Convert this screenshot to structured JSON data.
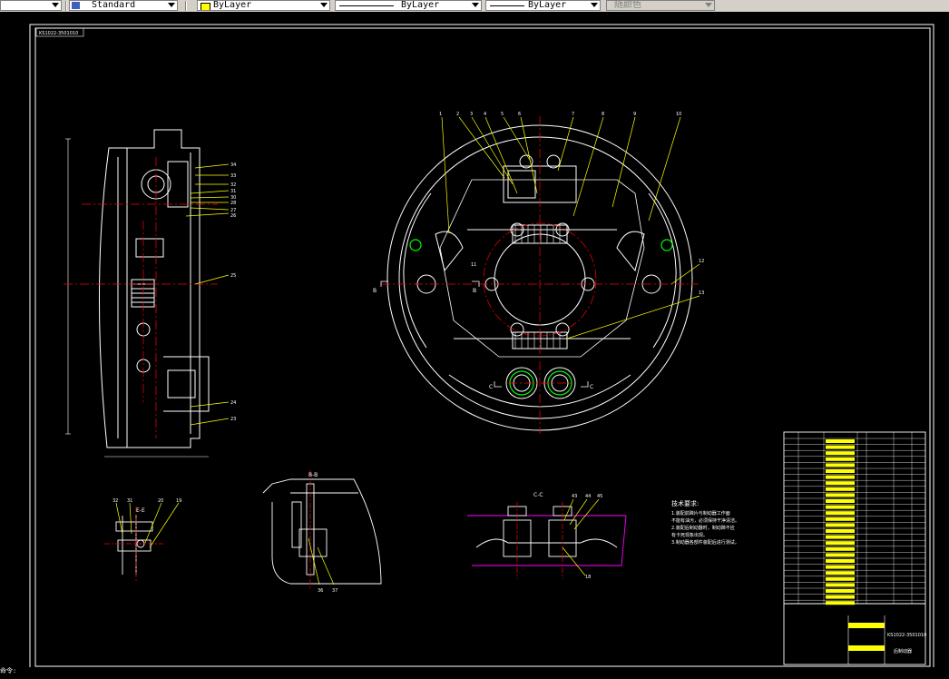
{
  "toolbar": {
    "text_style": "Standard",
    "layer": "ByLayer",
    "linetype": "ByLayer",
    "lineweight": "ByLayer",
    "plot_style": "随颜色"
  },
  "drawing": {
    "title_tag": "KS1022-3501010",
    "section_bb": "B-B",
    "section_cc": "C-C",
    "section_ee": "E-E",
    "label_b": "B",
    "label_c": "C",
    "tech_title": "技术要求:",
    "tech_lines": [
      "1.装配前蹄片与制动器工作面",
      "  不能有油污，必须保持干净清洁。",
      "2.装配后制动器时，制动蹄不应",
      "  有卡死现象出现。",
      "3.制动器各部件装配后进行测试。"
    ],
    "title_block_code": "KS1022-3501010",
    "title_block_name": "后制动器"
  },
  "callouts": {
    "front": [
      "1",
      "2",
      "3",
      "4",
      "5",
      "6",
      "7",
      "8",
      "9",
      "10",
      "11",
      "12",
      "13"
    ],
    "side": [
      "34",
      "33",
      "32",
      "31",
      "30",
      "28",
      "27",
      "26",
      "25",
      "24",
      "23"
    ],
    "ee": [
      "32",
      "31",
      "20",
      "19"
    ],
    "bb": [
      "36",
      "37"
    ],
    "cc": [
      "43",
      "44",
      "45",
      "18"
    ]
  },
  "colors": {
    "geometry": "#ffffff",
    "centerline": "#ff0000",
    "leader": "#ffff00",
    "hatch": "#00ff00",
    "section": "#ff00ff"
  },
  "status": {
    "command": "命令:"
  }
}
